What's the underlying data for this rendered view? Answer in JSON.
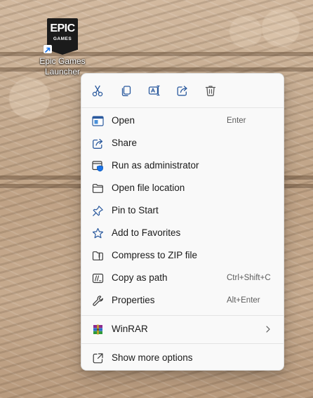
{
  "desktop": {
    "icon": {
      "logo_top": "EPIC",
      "logo_bottom": "GAMES",
      "label_line1": "Epic Games",
      "label_line2": "Launcher",
      "icon_name": "epic-games-logo"
    }
  },
  "context_menu": {
    "top_actions": [
      {
        "name": "cut-icon",
        "tooltip": "Cut"
      },
      {
        "name": "copy-icon",
        "tooltip": "Copy"
      },
      {
        "name": "rename-icon",
        "tooltip": "Rename"
      },
      {
        "name": "share-icon",
        "tooltip": "Share"
      },
      {
        "name": "delete-icon",
        "tooltip": "Delete"
      }
    ],
    "items": [
      {
        "label": "Open",
        "shortcut": "Enter",
        "icon": "open-app-icon"
      },
      {
        "label": "Share",
        "shortcut": "",
        "icon": "share-icon"
      },
      {
        "label": "Run as administrator",
        "shortcut": "",
        "icon": "run-as-admin-icon"
      },
      {
        "label": "Open file location",
        "shortcut": "",
        "icon": "folder-icon"
      },
      {
        "label": "Pin to Start",
        "shortcut": "",
        "icon": "pin-icon"
      },
      {
        "label": "Add to Favorites",
        "shortcut": "",
        "icon": "star-icon"
      },
      {
        "label": "Compress to ZIP file",
        "shortcut": "",
        "icon": "zip-folder-icon"
      },
      {
        "label": "Copy as path",
        "shortcut": "Ctrl+Shift+C",
        "icon": "copy-path-icon"
      },
      {
        "label": "Properties",
        "shortcut": "Alt+Enter",
        "icon": "wrench-icon"
      },
      {
        "label": "WinRAR",
        "shortcut": "",
        "icon": "winrar-icon",
        "has_submenu": true
      },
      {
        "label": "Show more options",
        "shortcut": "",
        "icon": "more-options-icon"
      }
    ],
    "accent_color": "#0067c0",
    "icon_color": "#2b5a9e"
  }
}
